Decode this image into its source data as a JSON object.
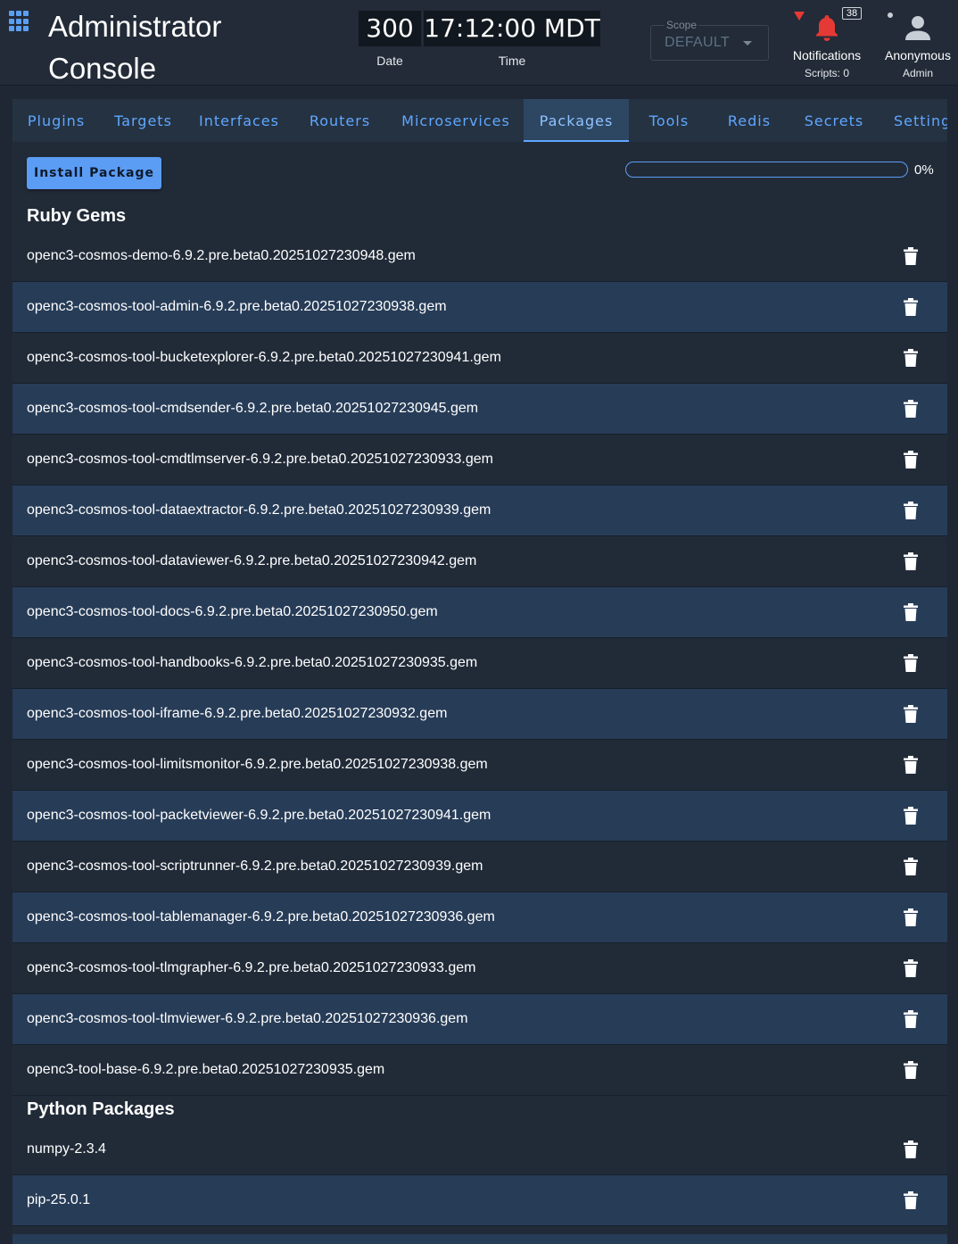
{
  "header": {
    "title_line1": "Administrator",
    "title_line2": "Console",
    "clock": {
      "date_value": "300",
      "date_label": "Date",
      "time_value": "17:12:00 MDT",
      "time_label": "Time"
    },
    "scope": {
      "label": "Scope",
      "value": "DEFAULT"
    },
    "notifications": {
      "count": "38",
      "label": "Notifications",
      "scripts": "Scripts: 0"
    },
    "user": {
      "name": "Anonymous",
      "role": "Admin"
    }
  },
  "tabs": [
    {
      "label": "Plugins"
    },
    {
      "label": "Targets"
    },
    {
      "label": "Interfaces"
    },
    {
      "label": "Routers"
    },
    {
      "label": "Microservices"
    },
    {
      "label": "Packages",
      "active": true
    },
    {
      "label": "Tools"
    },
    {
      "label": "Redis"
    },
    {
      "label": "Secrets"
    },
    {
      "label": "Settings"
    }
  ],
  "toolbar": {
    "install_label": "Install Package",
    "progress_percent": 0,
    "progress_text": "0%"
  },
  "ruby_section": {
    "title": "Ruby Gems",
    "gems": [
      "openc3-cosmos-demo-6.9.2.pre.beta0.20251027230948.gem",
      "openc3-cosmos-tool-admin-6.9.2.pre.beta0.20251027230938.gem",
      "openc3-cosmos-tool-bucketexplorer-6.9.2.pre.beta0.20251027230941.gem",
      "openc3-cosmos-tool-cmdsender-6.9.2.pre.beta0.20251027230945.gem",
      "openc3-cosmos-tool-cmdtlmserver-6.9.2.pre.beta0.20251027230933.gem",
      "openc3-cosmos-tool-dataextractor-6.9.2.pre.beta0.20251027230939.gem",
      "openc3-cosmos-tool-dataviewer-6.9.2.pre.beta0.20251027230942.gem",
      "openc3-cosmos-tool-docs-6.9.2.pre.beta0.20251027230950.gem",
      "openc3-cosmos-tool-handbooks-6.9.2.pre.beta0.20251027230935.gem",
      "openc3-cosmos-tool-iframe-6.9.2.pre.beta0.20251027230932.gem",
      "openc3-cosmos-tool-limitsmonitor-6.9.2.pre.beta0.20251027230938.gem",
      "openc3-cosmos-tool-packetviewer-6.9.2.pre.beta0.20251027230941.gem",
      "openc3-cosmos-tool-scriptrunner-6.9.2.pre.beta0.20251027230939.gem",
      "openc3-cosmos-tool-tablemanager-6.9.2.pre.beta0.20251027230936.gem",
      "openc3-cosmos-tool-tlmgrapher-6.9.2.pre.beta0.20251027230933.gem",
      "openc3-cosmos-tool-tlmviewer-6.9.2.pre.beta0.20251027230936.gem",
      "openc3-tool-base-6.9.2.pre.beta0.20251027230935.gem"
    ]
  },
  "python_section": {
    "title": "Python Packages",
    "packages": [
      "numpy-2.3.4",
      "pip-25.0.1"
    ]
  },
  "icons": {
    "app_menu": "app-grid-icon",
    "alert": "alert-triangle-icon",
    "bell": "bell-icon",
    "user": "account-icon",
    "delete": "trash-icon",
    "scope_dropdown": "chevron-down-icon"
  },
  "colors": {
    "accent": "#5b9cf5",
    "alert": "#e53935",
    "row_alt": "#273c57"
  }
}
